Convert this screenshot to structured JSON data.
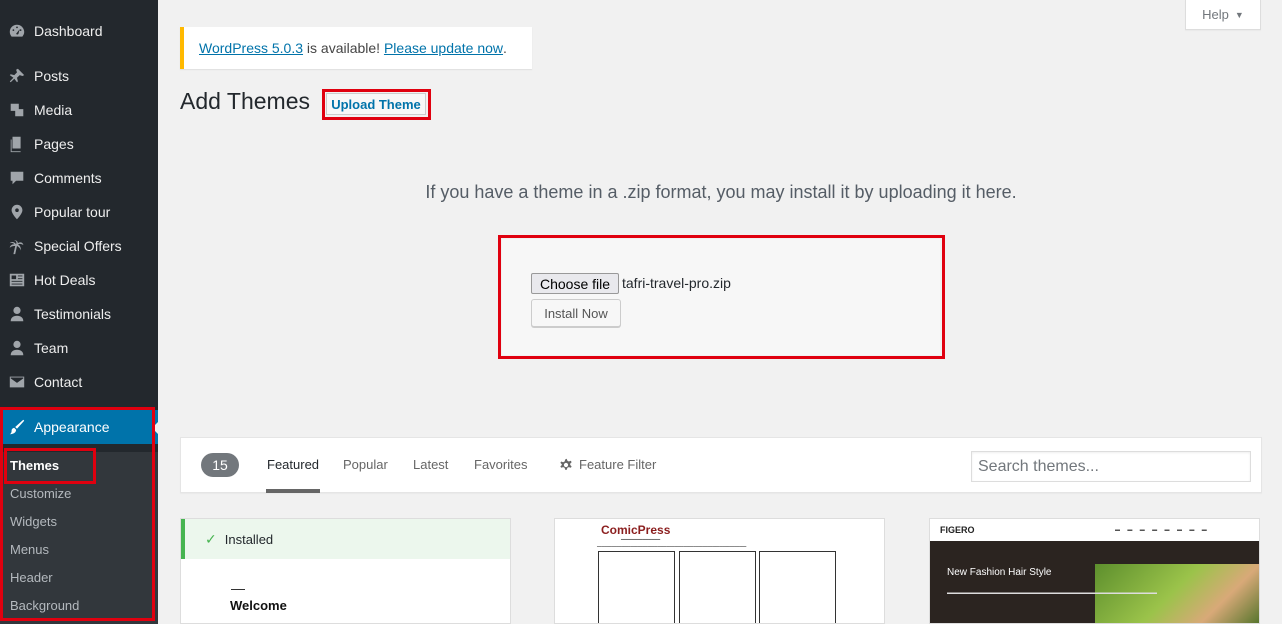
{
  "sidebar": {
    "items": [
      {
        "label": "Dashboard",
        "icon": "dashboard-icon"
      },
      {
        "label": "Posts",
        "icon": "pin-icon"
      },
      {
        "label": "Media",
        "icon": "media-icon"
      },
      {
        "label": "Pages",
        "icon": "pages-icon"
      },
      {
        "label": "Comments",
        "icon": "comment-icon"
      },
      {
        "label": "Popular tour",
        "icon": "location-icon"
      },
      {
        "label": "Special Offers",
        "icon": "palm-tree-icon"
      },
      {
        "label": "Hot Deals",
        "icon": "news-icon"
      },
      {
        "label": "Testimonials",
        "icon": "user-icon"
      },
      {
        "label": "Team",
        "icon": "user-icon"
      },
      {
        "label": "Contact",
        "icon": "email-icon"
      },
      {
        "label": "Appearance",
        "icon": "brush-icon"
      }
    ],
    "submenu": [
      "Themes",
      "Customize",
      "Widgets",
      "Menus",
      "Header",
      "Background"
    ]
  },
  "help": {
    "label": "Help"
  },
  "notice": {
    "version_link": "WordPress 5.0.3",
    "middle": " is available! ",
    "update_link": "Please update now",
    "end": "."
  },
  "header": {
    "title": "Add Themes",
    "upload_button": "Upload Theme"
  },
  "upload": {
    "help_text": "If you have a theme in a .zip format, you may install it by uploading it here.",
    "choose_file": "Choose file",
    "file_name": "tafri-travel-pro.zip",
    "install_button": "Install Now"
  },
  "filter": {
    "count": "15",
    "links": [
      "Featured",
      "Popular",
      "Latest",
      "Favorites"
    ],
    "feature_filter": "Feature Filter",
    "search_placeholder": "Search themes..."
  },
  "cards": {
    "installed": "Installed",
    "welcome": "Welcome",
    "comicpress_title": "ComicPress",
    "figero_logo": "FIGERO",
    "figero_heading": "New Fashion Hair Style"
  },
  "colors": {
    "sidebar": "#23282d",
    "accent": "#0073aa",
    "highlight_box": "#e0000f",
    "notice_border": "#ffb900",
    "installed_green": "#46b450"
  }
}
